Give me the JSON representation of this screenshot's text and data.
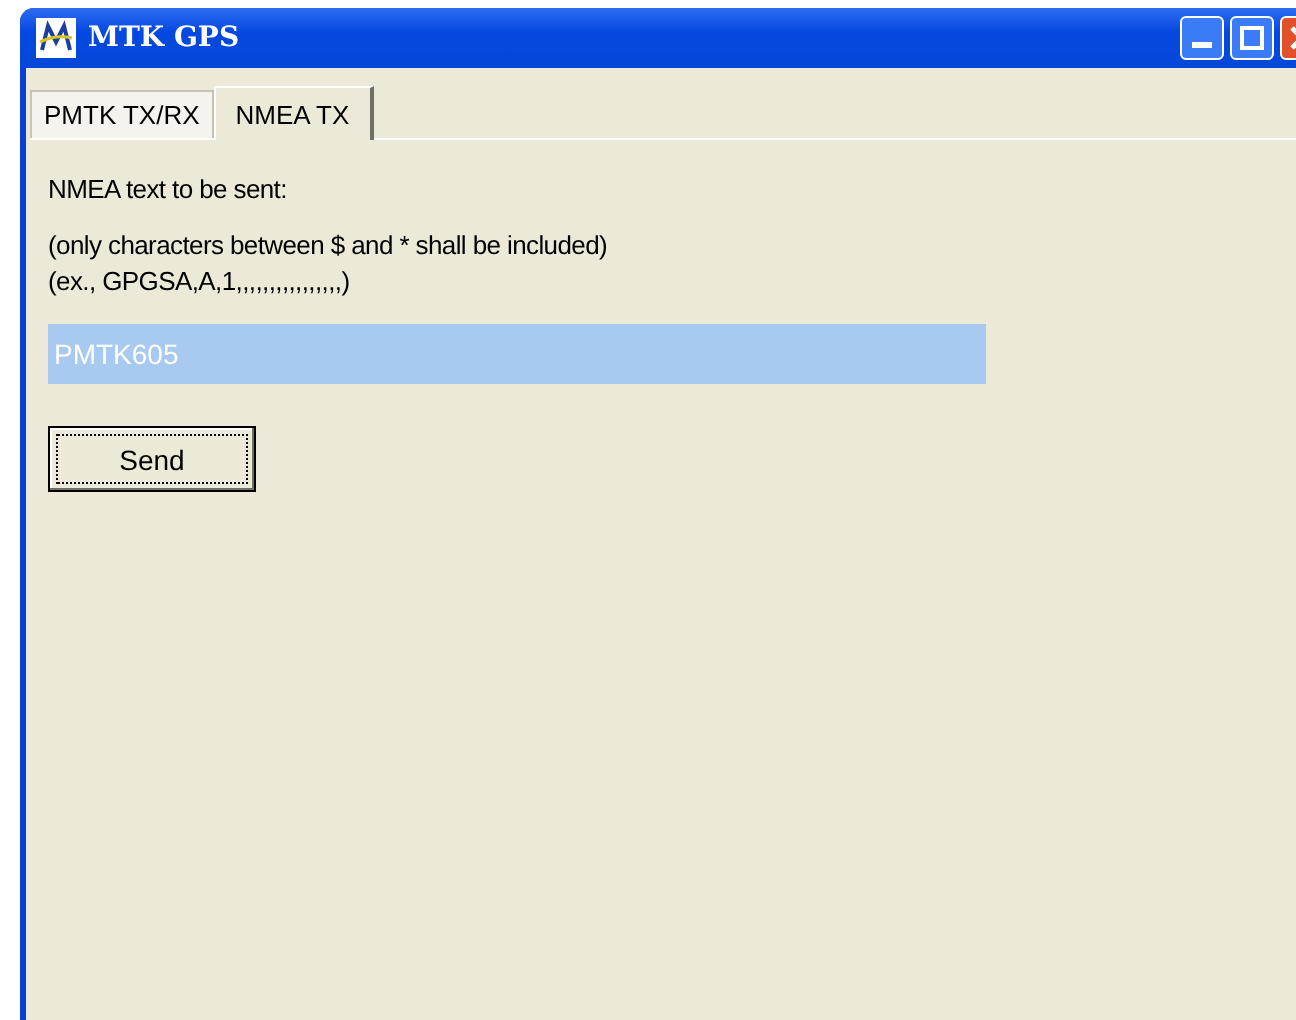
{
  "window": {
    "title": "MTK GPS"
  },
  "tabs": [
    {
      "label": "PMTK TX/RX",
      "selected": false
    },
    {
      "label": "NMEA TX",
      "selected": true
    }
  ],
  "label": "NMEA text to be sent:",
  "hint_lines": [
    "(only characters between $ and * shall be included)",
    "(ex., GPGSA,A,1,,,,,,,,,,,,,,,,)"
  ],
  "field": {
    "value": "PMTK605",
    "selected": true
  },
  "send_button": {
    "label": "Send"
  }
}
